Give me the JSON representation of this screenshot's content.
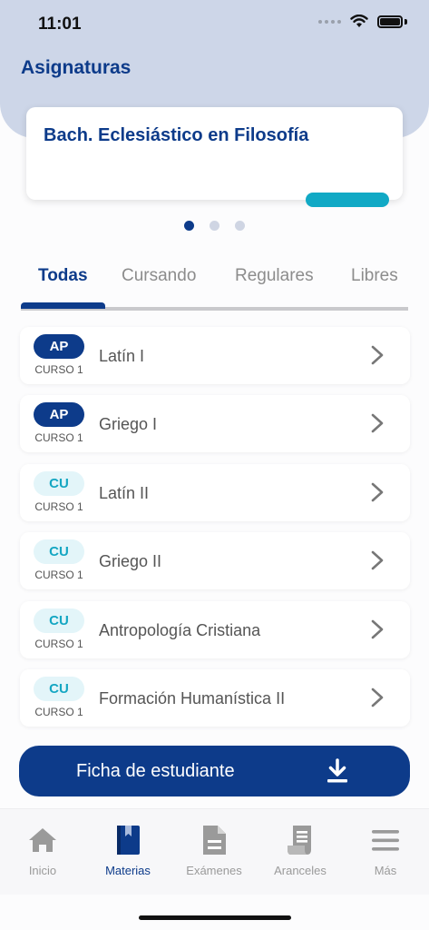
{
  "status_bar": {
    "time": "11:01"
  },
  "header": {
    "title": "Asignaturas"
  },
  "program_card": {
    "title": "Bach. Eclesiástico en Filosofía"
  },
  "pagination": {
    "count": 3,
    "active": 0
  },
  "tabs": [
    {
      "label": "Todas",
      "active": true
    },
    {
      "label": "Cursando",
      "active": false
    },
    {
      "label": "Regulares",
      "active": false
    },
    {
      "label": "Libres",
      "active": false
    }
  ],
  "subjects": [
    {
      "badge": "AP",
      "course": "CURSO 1",
      "name": "Latín I"
    },
    {
      "badge": "AP",
      "course": "CURSO 1",
      "name": "Griego I"
    },
    {
      "badge": "CU",
      "course": "CURSO 1",
      "name": "Latín II"
    },
    {
      "badge": "CU",
      "course": "CURSO 1",
      "name": "Griego II"
    },
    {
      "badge": "CU",
      "course": "CURSO 1",
      "name": "Antropología Cristiana"
    },
    {
      "badge": "CU",
      "course": "CURSO 1",
      "name": "Formación Humanística II"
    }
  ],
  "student_button": {
    "label": "Ficha de estudiante",
    "icon": "download-icon"
  },
  "bottom_nav": [
    {
      "label": "Inicio",
      "icon": "home-icon",
      "active": false
    },
    {
      "label": "Materias",
      "icon": "book-icon",
      "active": true
    },
    {
      "label": "Exámenes",
      "icon": "document-icon",
      "active": false
    },
    {
      "label": "Aranceles",
      "icon": "receipt-icon",
      "active": false
    },
    {
      "label": "Más",
      "icon": "menu-icon",
      "active": false
    }
  ],
  "colors": {
    "primary": "#0d3b8a",
    "accent": "#11a9c5",
    "header_bg": "#cdd6e8"
  }
}
